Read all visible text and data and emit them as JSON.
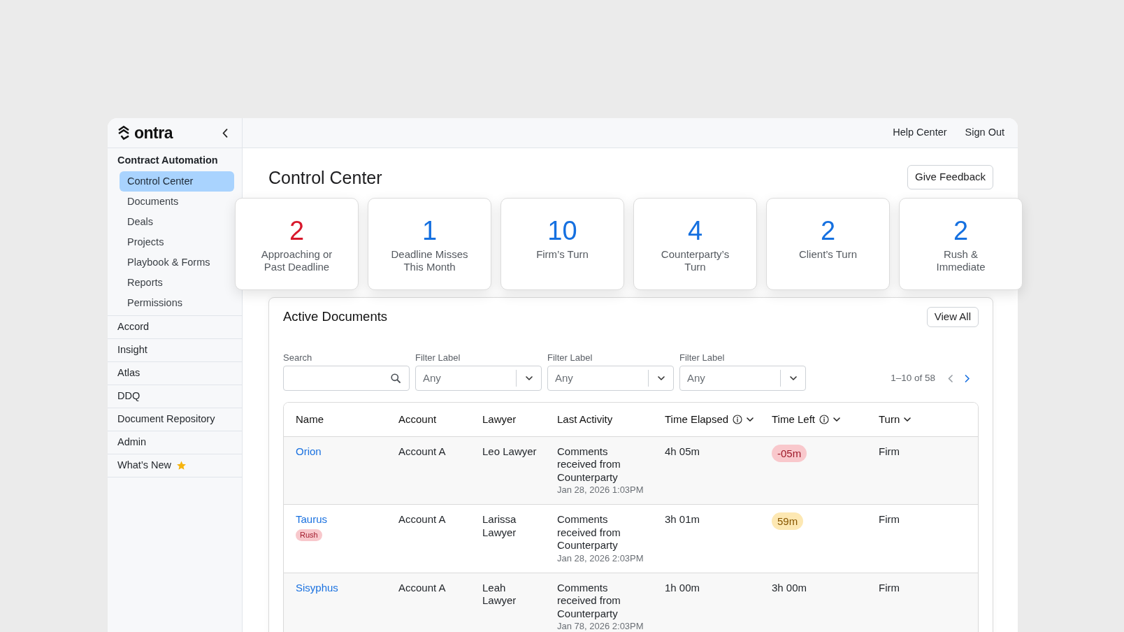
{
  "logo": {
    "text": "ontra"
  },
  "sidebar": {
    "section": {
      "label": "Contract Automation",
      "items": [
        {
          "label": "Control Center",
          "selected": true
        },
        {
          "label": "Documents",
          "selected": false
        },
        {
          "label": "Deals",
          "selected": false
        },
        {
          "label": "Projects",
          "selected": false
        },
        {
          "label": "Playbook & Forms",
          "selected": false
        },
        {
          "label": "Reports",
          "selected": false
        },
        {
          "label": "Permissions",
          "selected": false
        }
      ]
    },
    "items": [
      {
        "label": "Accord",
        "selected": false,
        "starred": false
      },
      {
        "label": "Insight",
        "selected": false,
        "starred": false
      },
      {
        "label": "Atlas",
        "selected": false,
        "starred": false
      },
      {
        "label": "DDQ",
        "selected": false,
        "starred": false
      },
      {
        "label": "Document Repository",
        "selected": false,
        "starred": false
      },
      {
        "label": "Admin",
        "selected": false,
        "starred": false
      },
      {
        "label": "What’s New",
        "selected": false,
        "starred": true
      }
    ]
  },
  "top_bar": {
    "links": [
      "Help Center",
      "Sign Out"
    ]
  },
  "title": "Control Center",
  "feedback_button": "Give Feedback",
  "stats": [
    {
      "value": "2",
      "label": "Approaching or Past Deadline",
      "color": "#d8182c"
    },
    {
      "value": "1",
      "label": "Deadline Misses This Month",
      "color": "#1570e0"
    },
    {
      "value": "10",
      "label": "Firm’s Turn",
      "color": "#1570e0"
    },
    {
      "value": "4",
      "label": "Counterparty’s Turn",
      "color": "#1570e0"
    },
    {
      "value": "2",
      "label": "Client’s Turn",
      "color": "#1570e0"
    },
    {
      "value": "2",
      "label": "Rush & Immediate",
      "color": "#1570e0"
    }
  ],
  "active_documents": {
    "title": "Active Documents",
    "view_all_button": "View All",
    "search": {
      "label": "Search"
    },
    "filters": [
      {
        "label": "Filter Label",
        "value": "Any"
      },
      {
        "label": "Filter Label",
        "value": "Any"
      },
      {
        "label": "Filter Label",
        "value": "Any"
      }
    ],
    "pagination": {
      "range": "1–10 of 58",
      "previous": {
        "disabled": true
      },
      "next": {
        "disabled": false
      }
    },
    "table": {
      "columns": [
        {
          "label": "Name",
          "info": false,
          "dropdown": false
        },
        {
          "label": "Account",
          "info": false,
          "dropdown": false
        },
        {
          "label": "Lawyer",
          "info": false,
          "dropdown": false
        },
        {
          "label": "Last Activity",
          "info": false,
          "dropdown": false
        },
        {
          "label": "Time Elapsed",
          "info": true,
          "dropdown": true
        },
        {
          "label": "Time Left",
          "info": true,
          "dropdown": true
        },
        {
          "label": "Turn",
          "info": false,
          "dropdown": true
        }
      ],
      "rows": [
        {
          "name": "Orion",
          "account": "Account A",
          "lawyer": "Leo Lawyer",
          "activity": "Comments received from Counterparty",
          "activity_time": "Jan 28, 2026 1:03PM",
          "time_elapsed": "4h 05m",
          "time_left": {
            "text": "-05m",
            "kind": "overdue"
          },
          "turn": "Firm"
        },
        {
          "name": "Taurus",
          "tags": [
            "Rush"
          ],
          "account": "Account A",
          "lawyer": "Larissa Lawyer",
          "activity": "Comments received from Counterparty",
          "activity_time": "Jan 28, 2026 2:03PM",
          "time_elapsed": "3h 01m",
          "time_left": {
            "text": "59m",
            "kind": "warning"
          },
          "turn": "Firm"
        },
        {
          "name": "Sisyphus",
          "account": "Account A",
          "lawyer": "Leah Lawyer",
          "activity": "Comments received from Counterparty",
          "activity_time": "Jan 78, 2026 2:03PM",
          "time_elapsed": "1h 00m",
          "time_left": {
            "text": "3h 00m",
            "kind": "normal"
          },
          "turn": "Firm"
        }
      ]
    }
  }
}
